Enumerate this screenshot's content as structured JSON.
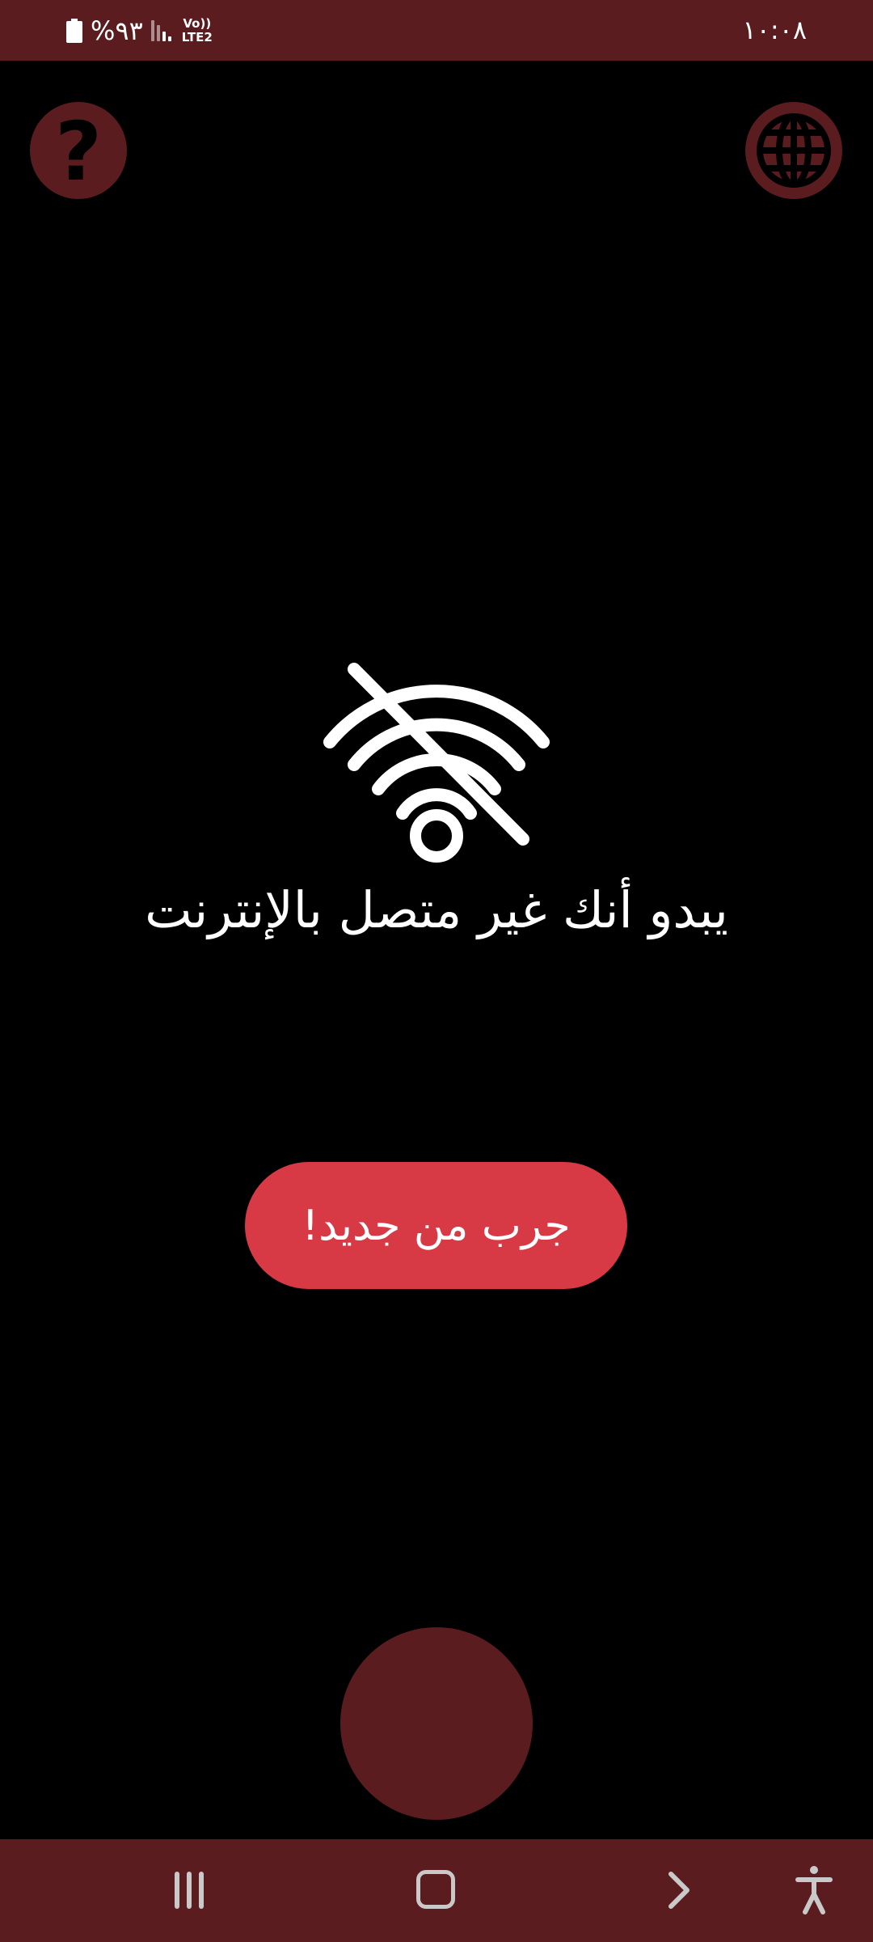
{
  "status_bar": {
    "time": "١٠:٠٨",
    "battery_percent": "%٩٣",
    "network_top": "Vo))",
    "network_bottom": "LTE2",
    "icons": [
      "battery-icon",
      "signal-icon"
    ]
  },
  "top_buttons": {
    "help_icon": "question-mark-icon",
    "help_glyph": "?",
    "language_icon": "globe-icon"
  },
  "main": {
    "status_icon": "wifi-off-icon",
    "message": "يبدو أنك غير متصل بالإنترنت",
    "retry_label": "جرب من جديد!"
  },
  "nav_bar": {
    "icons": [
      "recents-icon",
      "home-icon",
      "back-icon",
      "accessibility-icon"
    ]
  },
  "colors": {
    "background": "#000000",
    "bar_accent": "#5a1c1f",
    "retry_button": "#d73a44",
    "text": "#ffffff",
    "nav_icons": "#c9c9c9"
  }
}
